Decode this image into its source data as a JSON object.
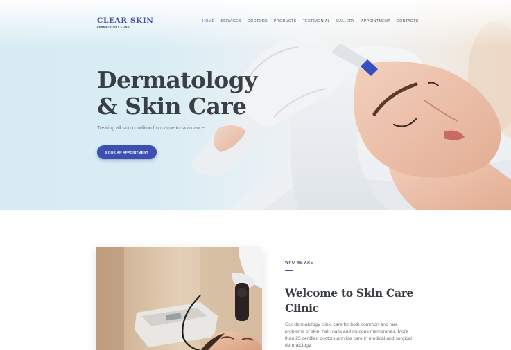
{
  "brand": {
    "name": "CLEAR SKIN",
    "subtitle": "DERMATOLOGY CLINIC"
  },
  "nav": {
    "items": [
      {
        "label": "HOME",
        "active": true
      },
      {
        "label": "SERVICES",
        "active": false
      },
      {
        "label": "DOCTORS",
        "active": false
      },
      {
        "label": "PRODUCTS",
        "active": false
      },
      {
        "label": "TESTIMONIAL",
        "active": false
      },
      {
        "label": "GALLERY",
        "active": false
      },
      {
        "label": "APPOINTMENT",
        "active": false
      },
      {
        "label": "CONTACTS",
        "active": false
      }
    ]
  },
  "hero": {
    "title_line1": "Dermatology",
    "title_line2": "& Skin Care",
    "subtitle": "Treating all skin condition from acne to skin cancer",
    "cta_label": "BOOK AN APPOINTMENT"
  },
  "about": {
    "eyebrow": "WHO WE ARE",
    "title": "Welcome to Skin Care Clinic",
    "text": "Our dermatology clinic care for both common and rare problems of skin, hair, nails and mucous membranes. More than 25 certified doctors provide care in medical and surgical dermatology."
  },
  "colors": {
    "accent": "#3d4fb0",
    "brand": "#3b4fa8",
    "heading": "#3a3f45",
    "hero_bg": "#d9ecf4"
  }
}
